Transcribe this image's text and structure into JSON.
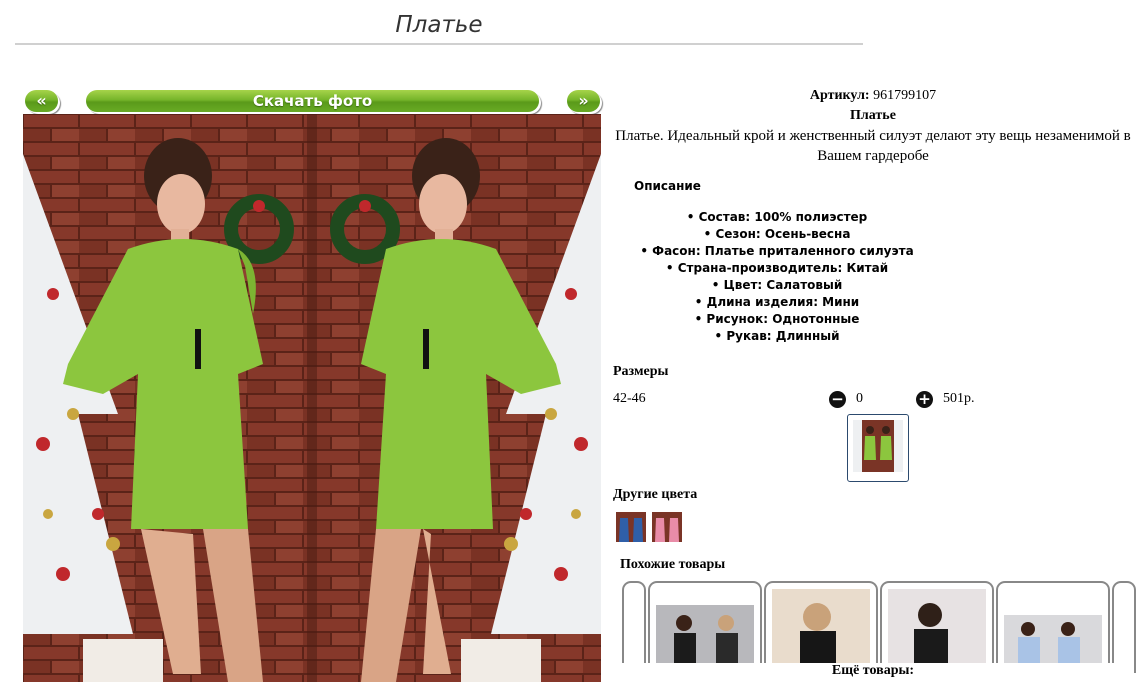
{
  "page": {
    "title": "Платье"
  },
  "photo_nav": {
    "prev_label": "«",
    "download_label": "Скачать фото",
    "next_label": "»"
  },
  "product": {
    "article_label": "Артикул:",
    "article_value": "961799107",
    "name": "Платье",
    "description": "Платье. Идеальный крой и женственный силуэт делают эту вещь незаменимой в Вашем гардеробе",
    "description_heading": "Описание",
    "properties": [
      "Состав: 100% полиэстер",
      "Сезон: Осень-весна",
      "Фасон: Платье приталенного силуэта",
      "Страна-производитель: Китай",
      "Цвет: Салатовый",
      "Длина изделия: Мини",
      "Рисунок: Однотонные",
      "Рукав: Длинный"
    ]
  },
  "sizes": {
    "heading": "Размеры",
    "rows": [
      {
        "size": "42-46",
        "quantity": "0",
        "price": "501р."
      }
    ],
    "minus_icon": "minus-circle-icon",
    "plus_icon": "plus-circle-icon"
  },
  "other_colors": {
    "heading": "Другие цвета"
  },
  "similar": {
    "heading": "Похожие товары",
    "more_label": "Ещё товары:"
  },
  "colors": {
    "dress": "#8cc63e",
    "brick": "#7a3426",
    "button_green": "#76b52a",
    "border": "#888888"
  }
}
